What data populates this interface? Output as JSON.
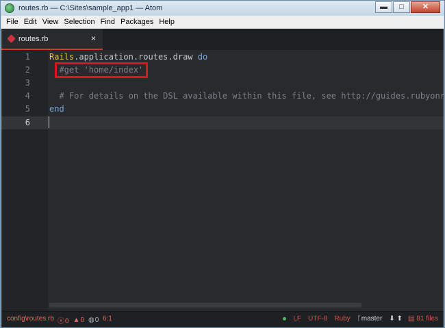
{
  "window": {
    "title": "routes.rb — C:\\Sites\\sample_app1 — Atom",
    "buttons": {
      "minimize": "▬",
      "maximize": "□",
      "close": "✕"
    }
  },
  "menu": [
    "File",
    "Edit",
    "View",
    "Selection",
    "Find",
    "Packages",
    "Help"
  ],
  "tab": {
    "label": "routes.rb",
    "close": "×",
    "icon": "ruby-gem-icon"
  },
  "editor": {
    "lines": [
      {
        "num": "1",
        "tokens": [
          {
            "text": "Rails",
            "type": "const"
          },
          {
            "text": ".application.routes.draw ",
            "type": "plain"
          },
          {
            "text": "do",
            "type": "kw"
          }
        ]
      },
      {
        "num": "2",
        "tokens": [
          {
            "text": "  #get 'home/index'",
            "type": "comment"
          }
        ]
      },
      {
        "num": "3",
        "tokens": []
      },
      {
        "num": "4",
        "tokens": [
          {
            "text": "  # For details on the DSL available within this file, see http://guides.rubyonrails.org/routing.html",
            "type": "comment"
          }
        ]
      },
      {
        "num": "5",
        "tokens": [
          {
            "text": "end",
            "type": "kw"
          }
        ]
      },
      {
        "num": "6",
        "tokens": []
      }
    ],
    "active_line": 6,
    "highlight_color": "#e0141c"
  },
  "status": {
    "path": "config\\routes.rb",
    "errors": "0",
    "warnings": "0",
    "infos": "0",
    "position": "6:1",
    "line_ending": "LF",
    "encoding": "UTF-8",
    "grammar": "Ruby",
    "branch": "master",
    "files": "81 files"
  }
}
